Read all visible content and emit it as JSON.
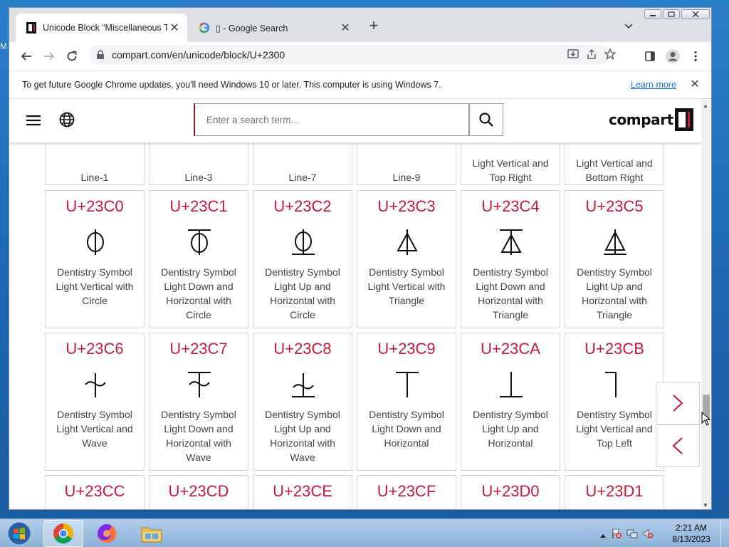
{
  "browser": {
    "tabs": [
      {
        "title": "Unicode Block “Miscellaneous Te",
        "close": "✕",
        "favicon": "compart-icon"
      },
      {
        "title": "▯ - Google Search",
        "close": "✕",
        "favicon": "google-icon"
      }
    ],
    "new_tab": "+",
    "url": "compart.com/en/unicode/block/U+2300"
  },
  "infobar": {
    "message": "To get future Google Chrome updates, you'll need Windows 10 or later. This computer is using Windows 7.",
    "link": "Learn more",
    "close": "✕"
  },
  "site": {
    "search_placeholder": "Enter a search term...",
    "logo_text": "compart"
  },
  "cards_top": [
    {
      "name": "Line-1"
    },
    {
      "name": "Line-3"
    },
    {
      "name": "Line-7"
    },
    {
      "name": "Line-9"
    },
    {
      "name": "Light Vertical and Top Right"
    },
    {
      "name": "Light Vertical and Bottom Right"
    }
  ],
  "cards_row1": [
    {
      "code": "U+23C0",
      "name": "Dentistry Symbol Light Vertical with Circle"
    },
    {
      "code": "U+23C1",
      "name": "Dentistry Symbol Light Down and Horizontal with Circle"
    },
    {
      "code": "U+23C2",
      "name": "Dentistry Symbol Light Up and Horizontal with Circle"
    },
    {
      "code": "U+23C3",
      "name": "Dentistry Symbol Light Vertical with Triangle"
    },
    {
      "code": "U+23C4",
      "name": "Dentistry Symbol Light Down and Horizontal with Triangle"
    },
    {
      "code": "U+23C5",
      "name": "Dentistry Symbol Light Up and Horizontal with Triangle"
    }
  ],
  "cards_row2": [
    {
      "code": "U+23C6",
      "name": "Dentistry Symbol Light Vertical and Wave"
    },
    {
      "code": "U+23C7",
      "name": "Dentistry Symbol Light Down and Horizontal with Wave"
    },
    {
      "code": "U+23C8",
      "name": "Dentistry Symbol Light Up and Horizontal with Wave"
    },
    {
      "code": "U+23C9",
      "name": "Dentistry Symbol Light Down and Horizontal"
    },
    {
      "code": "U+23CA",
      "name": "Dentistry Symbol Light Up and Horizontal"
    },
    {
      "code": "U+23CB",
      "name": "Dentistry Symbol Light Vertical and Top Left"
    }
  ],
  "cards_row3": [
    {
      "code": "U+23CC"
    },
    {
      "code": "U+23CD"
    },
    {
      "code": "U+23CE"
    },
    {
      "code": "U+23CF"
    },
    {
      "code": "U+23D0"
    },
    {
      "code": "U+23D1"
    }
  ],
  "taskbar": {
    "time": "2:21 AM",
    "date": "8/13/2023"
  },
  "desktop": {
    "stub_text": "M"
  },
  "colors": {
    "accent": "#c41a3b",
    "link": "#1a73e8"
  }
}
